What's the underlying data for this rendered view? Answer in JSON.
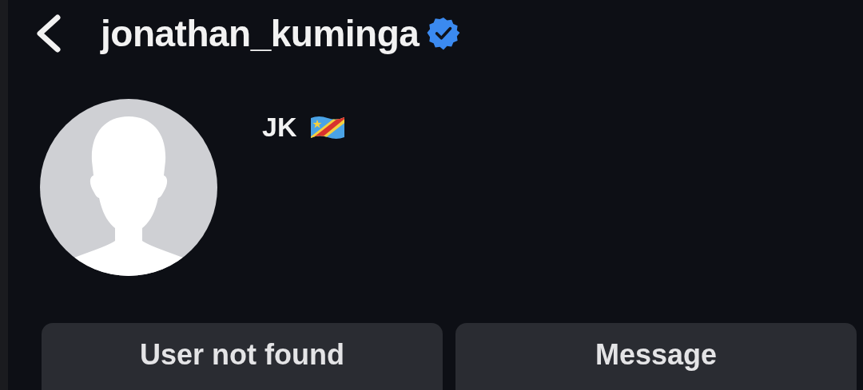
{
  "header": {
    "username": "jonathan_kuminga",
    "verified": true
  },
  "profile": {
    "avatar": {
      "kind": "placeholder"
    },
    "name": "JK"
  },
  "buttons": [
    {
      "label": "User not found"
    },
    {
      "label": "Message"
    }
  ]
}
